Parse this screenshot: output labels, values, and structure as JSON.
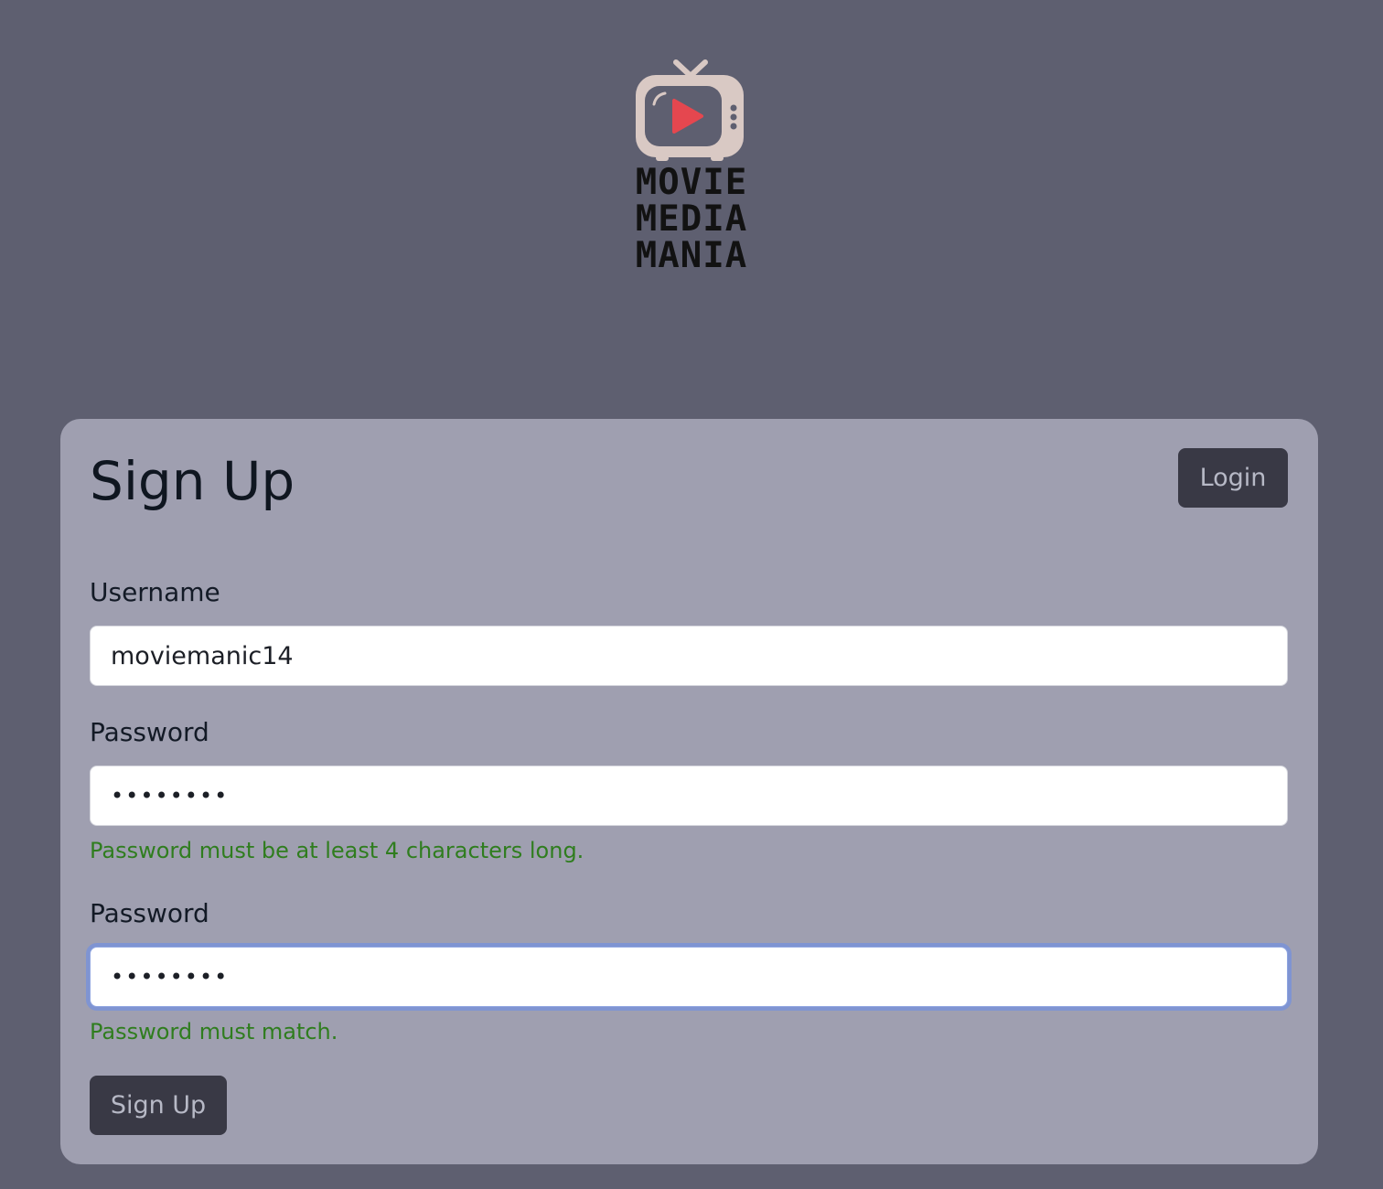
{
  "logo": {
    "lines": [
      "MOVIE",
      "MEDIA",
      "MANIA"
    ]
  },
  "card": {
    "title": "Sign Up",
    "login_label": "Login"
  },
  "form": {
    "username": {
      "label": "Username",
      "value": "moviemanic14"
    },
    "password": {
      "label": "Password",
      "value": "••••••••",
      "hint": "Password must be at least 4 characters long."
    },
    "confirm": {
      "label": "Password",
      "value": "••••••••",
      "hint": "Password must match."
    },
    "submit_label": "Sign Up"
  },
  "colors": {
    "page_bg": "#5e5f70",
    "card_bg": "#9f9fb0",
    "button_bg": "#393945",
    "hint": "#2f7d1e",
    "play_accent": "#e5474f"
  }
}
